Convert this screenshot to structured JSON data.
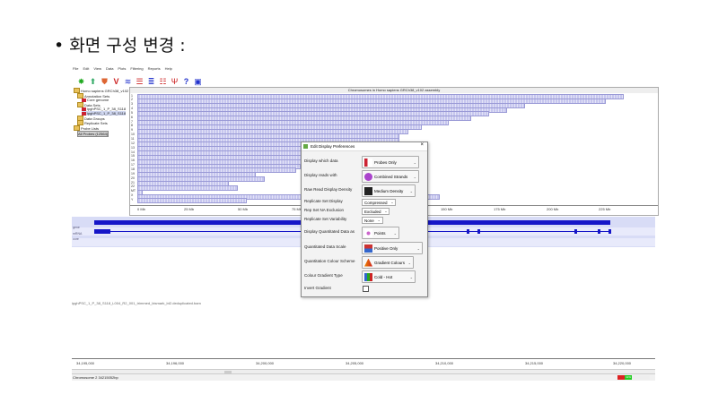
{
  "slide": {
    "bullet": "•",
    "title": "화면 구성 변경 :"
  },
  "app": {
    "menu": [
      "File",
      "Edit",
      "View",
      "Data",
      "Plots",
      "Filtering",
      "Reports",
      "Help"
    ],
    "tree": {
      "root": "Homo sapiens GRCh38_v102",
      "annotation_sets": "Annotation Sets",
      "core_genome": "Core genome",
      "data_sets": "Data Sets",
      "dataset1": "ipghPSC_1_P_38_S118",
      "dataset2": "ipghPSC_1_P_38_S118",
      "data_groups": "Data Groups",
      "replicate_sets": "Replicate Sets",
      "probe_lists": "Probe Lists",
      "all_probes": "All Probes (12564)"
    },
    "chrom_title": "Chromosomes in Homo sapiens GRCh38_v102 assembly",
    "chrom_labels": [
      "1",
      "2",
      "3",
      "4",
      "5",
      "6",
      "7",
      "8",
      "9",
      "10",
      "11",
      "12",
      "13",
      "14",
      "15",
      "16",
      "17",
      "18",
      "19",
      "20",
      "21",
      "22",
      "MT",
      "X",
      "Y"
    ],
    "axis_ticks": [
      "0 Mb",
      "25 Mb",
      "50 Mb",
      "75 Mb",
      "100 Mb",
      "125 Mb",
      "150 Mb",
      "175 Mb",
      "200 Mb",
      "225 Mb"
    ],
    "gene_labels": [
      "gene",
      "mRNA",
      "core"
    ],
    "filename": "ipghPSC_1_P_38_S118_L004_R2_001_trimmed_bismark_bt2.deduplicated.bam",
    "ruler_ticks": [
      "34,195,000",
      "34,196,000",
      "34,200,000",
      "34,205,000",
      "34,210,000",
      "34,215,000",
      "34,220,000"
    ],
    "status": "Chromosome 2 34215052bp",
    "memory": {
      "label": "11%",
      "used_fraction": 0.11
    }
  },
  "dialog": {
    "title": "Edit Display Preferences",
    "close": "×",
    "rows": [
      {
        "label": "Display which data",
        "value": "Probes Only",
        "swatch": "#c23"
      },
      {
        "label": "Display reads with",
        "value": "Combined Strands",
        "swatch": "#a4c"
      },
      {
        "label": "Raw Read Display Density",
        "value": "Medium Density",
        "swatch": "#222"
      },
      {
        "label": "Replicate Set Display",
        "value": "Compressed"
      },
      {
        "label": "Rep Set NA Exclusion",
        "value": "Excluded"
      },
      {
        "label": "Replicate Set Variability",
        "value": "None"
      },
      {
        "label": "Display Quantitated Data as",
        "value": "Points",
        "swatch": "#c6c"
      },
      {
        "label": "Quantitated Data Scale",
        "value": "Positive Only",
        "swatch": "#c33"
      },
      {
        "label": "Quantitation Colour Scheme",
        "value": "Gradient Colours",
        "swatch": "#e80"
      },
      {
        "label": "Colour Gradient Type",
        "value": "Cold - Hot",
        "swatch": "#36c"
      },
      {
        "label": "Invert Gradient",
        "value": ""
      }
    ]
  }
}
